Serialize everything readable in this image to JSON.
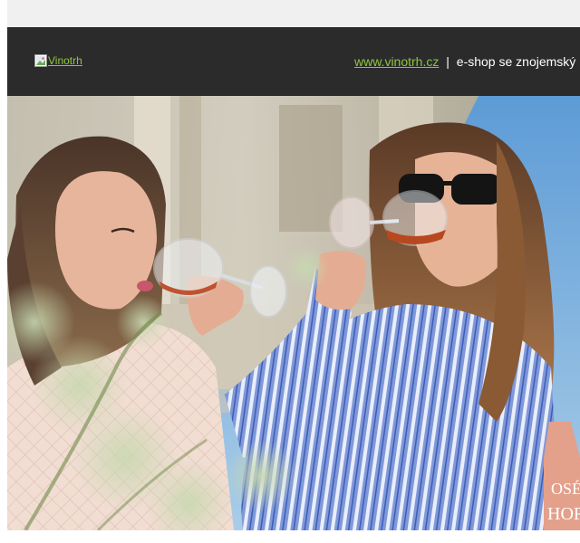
{
  "header": {
    "logo_alt": "Vinotrh",
    "site_link": "www.vinotrh.cz",
    "separator": "|",
    "tagline": "e-shop se znojemský"
  },
  "hero": {
    "bottle_label_top": "OSÉ",
    "bottle_label_bottom": "HOR"
  },
  "colors": {
    "header_bg": "#2b2b2b",
    "link_green": "#8cc63f",
    "sky_blue": "#8fb8dc"
  }
}
